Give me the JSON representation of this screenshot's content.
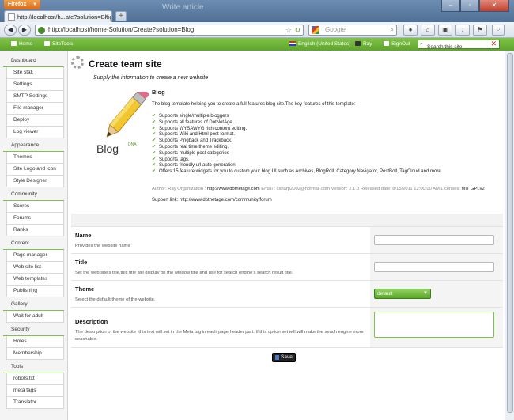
{
  "browser": {
    "menu_button": "Firefox",
    "window_caption": "Write article",
    "tab_title": "http://localhost/h...ate?solution=Blog",
    "url": "http://localhost/home-Solution/Create?solution=Blog",
    "search_engine_placeholder": "Google"
  },
  "sitebar": {
    "home": "Home",
    "sitetools": "SiteTools",
    "language": "English (United States)",
    "user": "Ray",
    "signout": "SignOut",
    "search_placeholder": "Search this site"
  },
  "sidebar": [
    {
      "category": "Dashboard",
      "items": [
        "Site stat.",
        "Settings",
        "SMTP Settings",
        "File manager",
        "Deploy",
        "Log viewer"
      ]
    },
    {
      "category": "Appearance",
      "items": [
        "Themes",
        "Site Logo and icon",
        "Style Designer"
      ]
    },
    {
      "category": "Community",
      "items": [
        "Scores",
        "Forums",
        "Ranks"
      ]
    },
    {
      "category": "Content",
      "items": [
        "Page manager",
        "Web site list",
        "Web templates",
        "Publishing"
      ]
    },
    {
      "category": "Gallery",
      "items": [
        "Wait for adult"
      ]
    },
    {
      "category": "Security",
      "items": [
        "Roles",
        "Membership"
      ]
    },
    {
      "category": "Tools",
      "items": [
        "robots.txt",
        "meta tags",
        "Translator"
      ]
    }
  ],
  "page": {
    "title": "Create team site",
    "subtitle": "Supply the information to create a new website"
  },
  "template": {
    "name": "Blog",
    "logo_text": "Blog",
    "logo_badge": "DNA",
    "description": "The blog template helping you to create a full features blog site.The key features of this template:",
    "features": [
      "Supports single/multiple bloggers",
      "Supports all features of DotNetAge.",
      "Supports WYSAWYG rich content editing.",
      "Supports Wiki and Html post format.",
      "Supports Pingback and Trackback.",
      "Supports real time theme editing.",
      "Supports multiple post categories",
      "Supports tags.",
      "Supports friendly url auto generation.",
      "Offers 15 feature widgets for you to custom your blog UI such as Archives, BlogRoll, Category Navigator, PostBoll, TagCloud and more."
    ],
    "meta": {
      "author_label": "Author: Ray Organization :",
      "org_url": "http://www.dotnetage.com",
      "email_label": "Email : csharp2002@hotmail.com Version: 2.1.0 Released date: 8/15/2011 12:00:00 AM Licenses:",
      "license": "MIT GPLv2"
    },
    "support": "Support link: http://www.dotnetage.com/community/forum"
  },
  "form": {
    "name": {
      "label": "Name",
      "help": "Provides the website name",
      "value": ""
    },
    "title": {
      "label": "Title",
      "help": "Set the web site's title,this title will display on the window title and use for search engine's search result title.",
      "value": ""
    },
    "theme": {
      "label": "Theme",
      "help": "Select the default theme of the website.",
      "value": "default"
    },
    "description": {
      "label": "Description",
      "help": "The description of the website ,this text will set in the Meta tag in each page header part. If this option set will will make the seach engine more seachable.",
      "value": ""
    },
    "save_label": "Save"
  }
}
